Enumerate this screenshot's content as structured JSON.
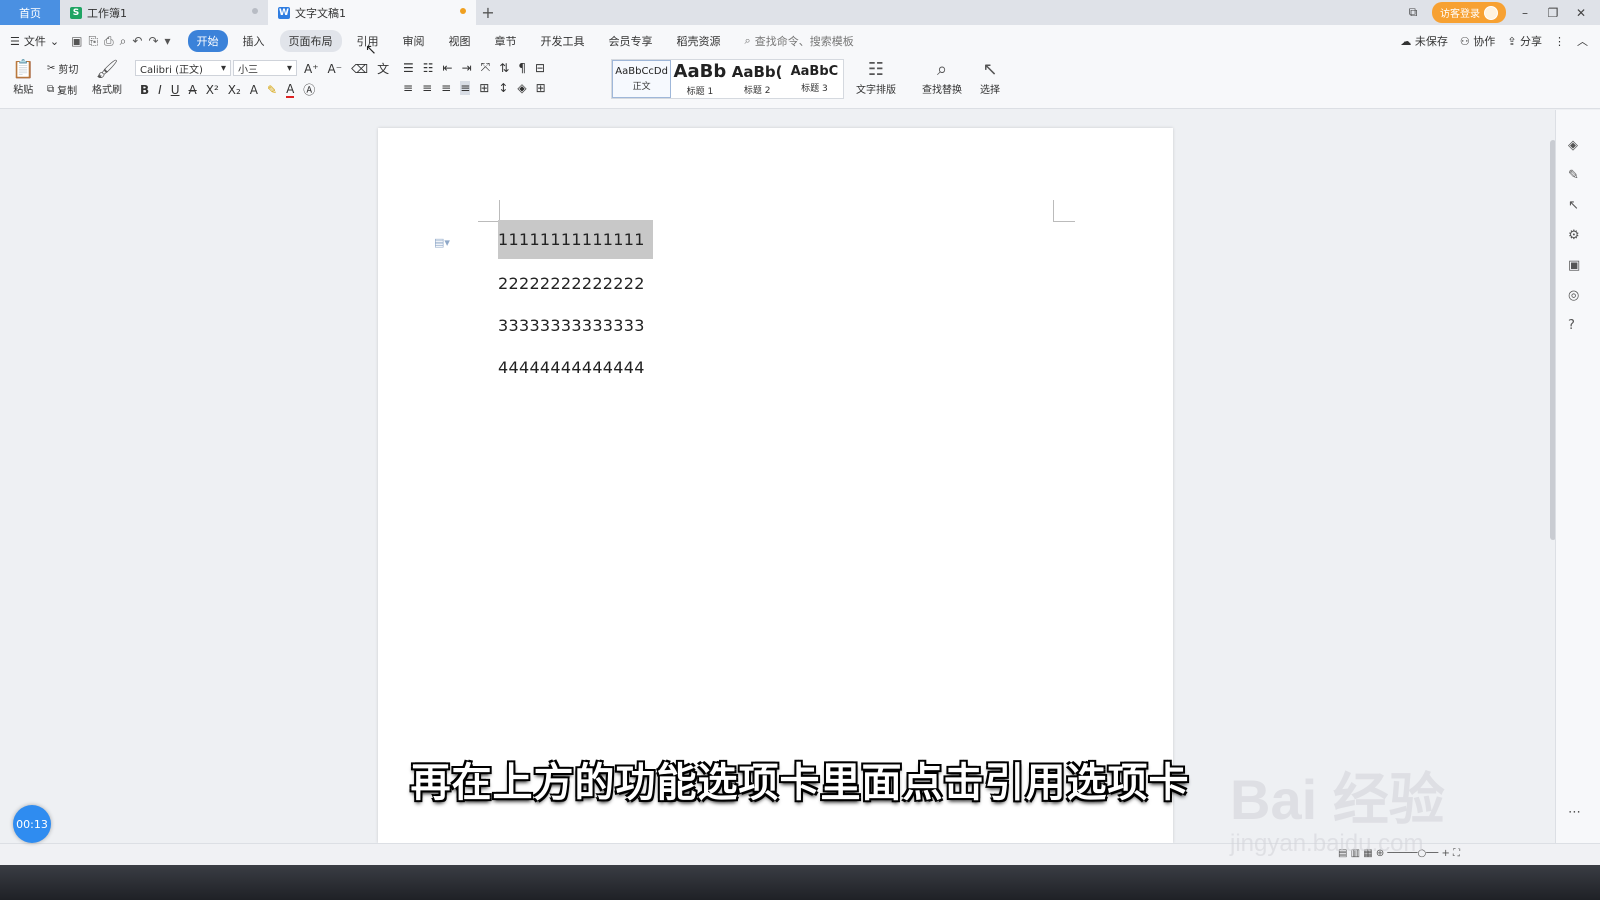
{
  "tabs": {
    "home": "首页",
    "items": [
      {
        "label": "工作簿1",
        "icon": "S",
        "icon_color": "#1fa463",
        "active": false
      },
      {
        "label": "文字文稿1",
        "icon": "W",
        "icon_color": "#2f7de1",
        "active": true
      }
    ],
    "add": "+"
  },
  "account": {
    "login_label": "访客登录"
  },
  "window_controls": {
    "minimize": "–",
    "restore": "❐",
    "close": "✕"
  },
  "menu": {
    "file": "文件",
    "tabs": [
      "开始",
      "插入",
      "页面布局",
      "引用",
      "审阅",
      "视图",
      "章节",
      "开发工具",
      "会员专享",
      "稻壳资源"
    ],
    "active_tab": "开始",
    "hover_tab": "页面布局",
    "search_placeholder": "查找命令、搜索模板",
    "right": {
      "unsaved": "未保存",
      "collab": "协作",
      "share": "分享"
    }
  },
  "ribbon": {
    "paste": "粘贴",
    "cut": "剪切",
    "copy": "复制",
    "format_painter": "格式刷",
    "font_name": "Calibri (正文)",
    "font_size": "小三",
    "styles": [
      {
        "preview": "AaBbCcDd",
        "label": "正文"
      },
      {
        "preview": "AaBb",
        "label": "标题 1"
      },
      {
        "preview": "AaBb(",
        "label": "标题 2"
      },
      {
        "preview": "AaBbC",
        "label": "标题 3"
      }
    ],
    "text_layout": "文字排版",
    "find_replace": "查找替换",
    "select": "选择"
  },
  "document": {
    "lines": [
      "11111111111111",
      "22222222222222",
      "33333333333333",
      "44444444444444"
    ],
    "selected_line": 0
  },
  "caption": "再在上方的功能选项卡里面点击引用选项卡",
  "timer": "00:13",
  "watermark": {
    "brand": "Bai 经验",
    "url": "jingyan.baidu.com"
  },
  "colors": {
    "accent": "#3b82d9",
    "login": "#f7a132",
    "timer": "#2f8cf0"
  }
}
